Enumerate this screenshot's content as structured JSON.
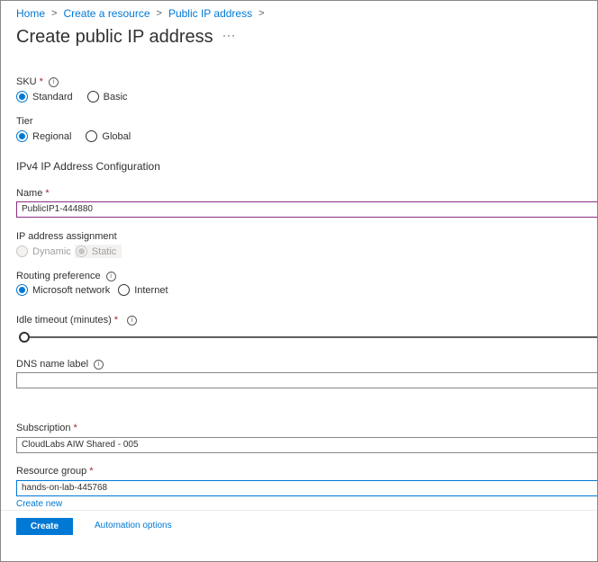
{
  "breadcrumb": {
    "items": [
      "Home",
      "Create a resource",
      "Public IP address"
    ]
  },
  "page": {
    "title": "Create public IP address",
    "more": "···"
  },
  "sku": {
    "label": "SKU",
    "options": [
      "Standard",
      "Basic"
    ],
    "selected": "Standard"
  },
  "tier": {
    "label": "Tier",
    "options": [
      "Regional",
      "Global"
    ],
    "selected": "Regional"
  },
  "ipv4": {
    "heading": "IPv4 IP Address Configuration"
  },
  "name": {
    "label": "Name",
    "value": "PublicIP1-444880"
  },
  "assignment": {
    "label": "IP address assignment",
    "options": [
      "Dynamic",
      "Static"
    ],
    "selected": "Static"
  },
  "routing": {
    "label": "Routing preference",
    "options": [
      "Microsoft network",
      "Internet"
    ],
    "selected": "Microsoft network"
  },
  "idle_timeout": {
    "label": "Idle timeout (minutes)",
    "level": 0
  },
  "dns": {
    "label": "DNS name label",
    "value": ""
  },
  "subscription": {
    "label": "Subscription",
    "value": "CloudLabs AIW Shared - 005"
  },
  "resource_group": {
    "label": "Resource group",
    "value": "hands-on-lab-445768",
    "create_new": "Create new"
  },
  "footer": {
    "create": "Create",
    "automation": "Automation options"
  },
  "required_mark": "*",
  "info_glyph": "i",
  "colors": {
    "accent": "#0078d4",
    "required": "#a4262c",
    "error_border": "#8b2d84"
  }
}
